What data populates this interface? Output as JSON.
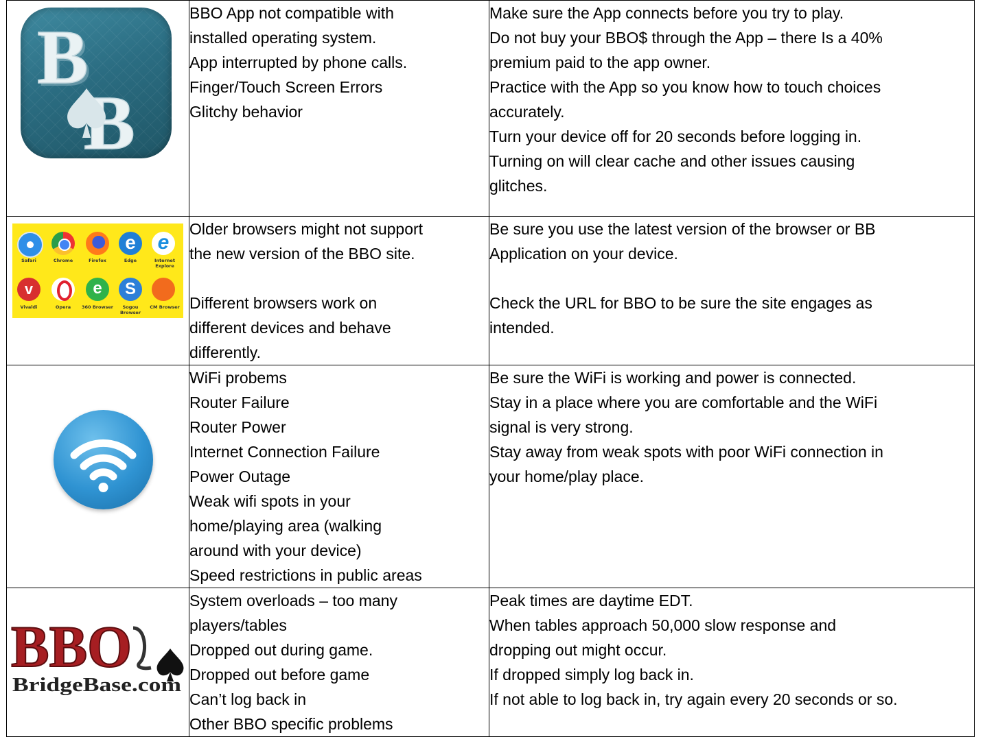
{
  "rows": [
    {
      "icon": "bb-app-icon",
      "problems": [
        "BBO App not compatible with",
        "installed operating system.",
        "App interrupted by phone calls.",
        "Finger/Touch Screen Errors",
        "Glitchy behavior"
      ],
      "solutions": [
        "Make sure the App connects before you try to play.",
        "Do not buy your BBO$ through the App – there Is a 40%",
        "premium paid to the app owner.",
        "Practice with the App so you know how to touch choices",
        "accurately.",
        "Turn your device off for 20 seconds before logging in.",
        "Turning on will clear cache and other issues causing",
        "glitches."
      ],
      "icon_text": {
        "letter1": "B",
        "letter2": "B"
      }
    },
    {
      "icon": "browsers-icon",
      "problems": [
        "Older browsers might not support",
        "the new version of the BBO site.",
        "",
        "Different browsers work on",
        "different devices and behave",
        "differently."
      ],
      "solutions": [
        "Be sure you use the latest version of the browser or BB",
        "Application on your device.",
        "",
        "Check the URL for BBO to be sure the site engages as",
        "intended."
      ],
      "browser_labels": [
        "Safari",
        "Chrome",
        "Firefox",
        "Edge",
        "Internet Explore",
        "Vivaldi",
        "Opera",
        "360 Browser",
        "Sogou Browser",
        "CM Browser"
      ]
    },
    {
      "icon": "wifi-icon",
      "problems": [
        "WiFi probems",
        "Router Failure",
        "Router Power",
        "Internet Connection Failure",
        "Power Outage",
        "Weak wifi spots in your",
        "home/playing area (walking",
        "around with your device)",
        "Speed restrictions in public areas"
      ],
      "solutions": [
        "Be sure the WiFi is working and power is connected.",
        "Stay in a place where you are comfortable and the WiFi",
        "signal is very strong.",
        "Stay away from weak spots with poor WiFi connection in",
        "your home/play place."
      ]
    },
    {
      "icon": "bbo-logo",
      "problems": [
        "System overloads – too many",
        "players/tables",
        "Dropped out during game.",
        "Dropped out before game",
        "Can’t log back in",
        "Other BBO specific problems"
      ],
      "solutions": [
        "Peak times are daytime EDT.",
        "When tables approach 50,000 slow response and",
        "dropping out might occur.",
        "If dropped simply log back in.",
        "If not able to log back in, try again every 20 seconds or so."
      ],
      "logo_text": {
        "main": "BBO",
        "sub": "BridgeBase.com"
      }
    }
  ]
}
